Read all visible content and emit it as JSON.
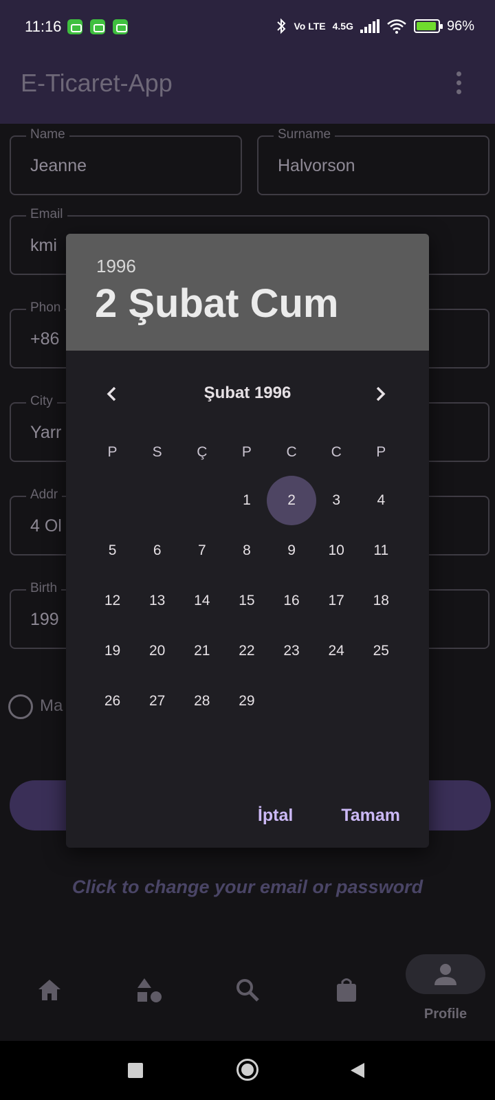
{
  "status_bar": {
    "time": "11:16",
    "network": "4.5G",
    "volte": "Vo LTE",
    "battery": "96%",
    "icons": [
      "notification-app-icon",
      "notification-app-icon",
      "notification-app-icon",
      "bluetooth-icon",
      "signal-icon",
      "wifi-icon",
      "battery-charging-icon"
    ]
  },
  "app_bar": {
    "title": "E-Ticaret-App",
    "menu_icon": "more-vert-icon"
  },
  "form": {
    "name": {
      "label": "Name",
      "value": "Jeanne"
    },
    "surname": {
      "label": "Surname",
      "value": "Halvorson"
    },
    "email": {
      "label": "Email",
      "value": "kmi"
    },
    "phone": {
      "label": "Phon",
      "value": "+86"
    },
    "city": {
      "label": "City",
      "value": "Yarr"
    },
    "address": {
      "label": "Addr",
      "value": "4 Ol"
    },
    "birth": {
      "label": "Birth",
      "value": "199"
    },
    "gender_option": "Ma"
  },
  "change_link": "Click to change your email or password",
  "bottom_nav": {
    "items": [
      "home-icon",
      "categories-icon",
      "search-icon",
      "shopping-bag-icon",
      "profile-icon"
    ],
    "active_label": "Profile"
  },
  "dialog": {
    "header_year": "1996",
    "header_date": "2 Şubat Cum",
    "month_label": "Şubat 1996",
    "weekdays": [
      "P",
      "S",
      "Ç",
      "P",
      "C",
      "C",
      "P"
    ],
    "weeks": [
      [
        "",
        "",
        "",
        "1",
        "2",
        "3",
        "4"
      ],
      [
        "5",
        "6",
        "7",
        "8",
        "9",
        "10",
        "11"
      ],
      [
        "12",
        "13",
        "14",
        "15",
        "16",
        "17",
        "18"
      ],
      [
        "19",
        "20",
        "21",
        "22",
        "23",
        "24",
        "25"
      ],
      [
        "26",
        "27",
        "28",
        "29",
        "",
        "",
        ""
      ]
    ],
    "selected_day": "2",
    "cancel_label": "İptal",
    "ok_label": "Tamam"
  },
  "colors": {
    "app_bar": "#2b233e",
    "dialog_header": "#5b5b5b",
    "dialog_body": "#1f1e23",
    "selected_day": "#4e4563",
    "dialog_button_text": "#cbb8f5"
  }
}
